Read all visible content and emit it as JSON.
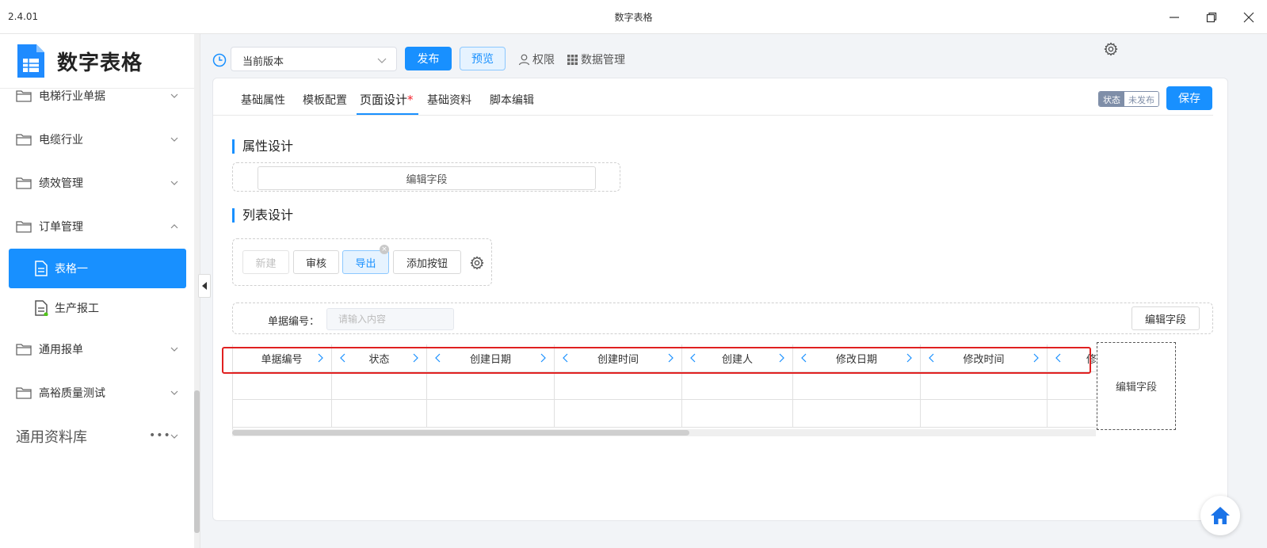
{
  "window": {
    "version": "2.4.01",
    "title": "数字表格"
  },
  "brand": {
    "name": "数字表格"
  },
  "sidebar": {
    "items": [
      {
        "label": "电梯行业单据"
      },
      {
        "label": "电缆行业"
      },
      {
        "label": "绩效管理"
      },
      {
        "label": "订单管理"
      },
      {
        "label": "通用报单"
      },
      {
        "label": "高裕质量测试"
      }
    ],
    "sub_items": [
      {
        "label": "表格一"
      },
      {
        "label": "生产报工"
      }
    ],
    "library": {
      "label": "通用资料库",
      "more": "•••"
    }
  },
  "toolbar": {
    "version_select": "当前版本",
    "publish_label": "发布",
    "preview_label": "预览",
    "permission_label": "权限",
    "data_manage_label": "数据管理"
  },
  "tabs": [
    {
      "label": "基础属性"
    },
    {
      "label": "模板配置"
    },
    {
      "label": "页面设计",
      "mark": "*"
    },
    {
      "label": "基础资料"
    },
    {
      "label": "脚本编辑"
    }
  ],
  "status": {
    "key": "状态",
    "value": "未发布"
  },
  "save_label": "保存",
  "attr_design": {
    "title": "属性设计",
    "edit_field": "编辑字段"
  },
  "list_design": {
    "title": "列表设计",
    "buttons": [
      {
        "label": "新建"
      },
      {
        "label": "审核"
      },
      {
        "label": "导出"
      },
      {
        "label": "添加按钮"
      }
    ],
    "close_mark": "×",
    "filter": {
      "label": "单据编号：",
      "placeholder": "请输入内容",
      "edit_field": "编辑字段"
    },
    "columns": [
      "单据编号",
      "状态",
      "创建日期",
      "创建时间",
      "创建人",
      "修改日期",
      "修改时间",
      "修"
    ],
    "table_edit_field": "编辑字段"
  }
}
